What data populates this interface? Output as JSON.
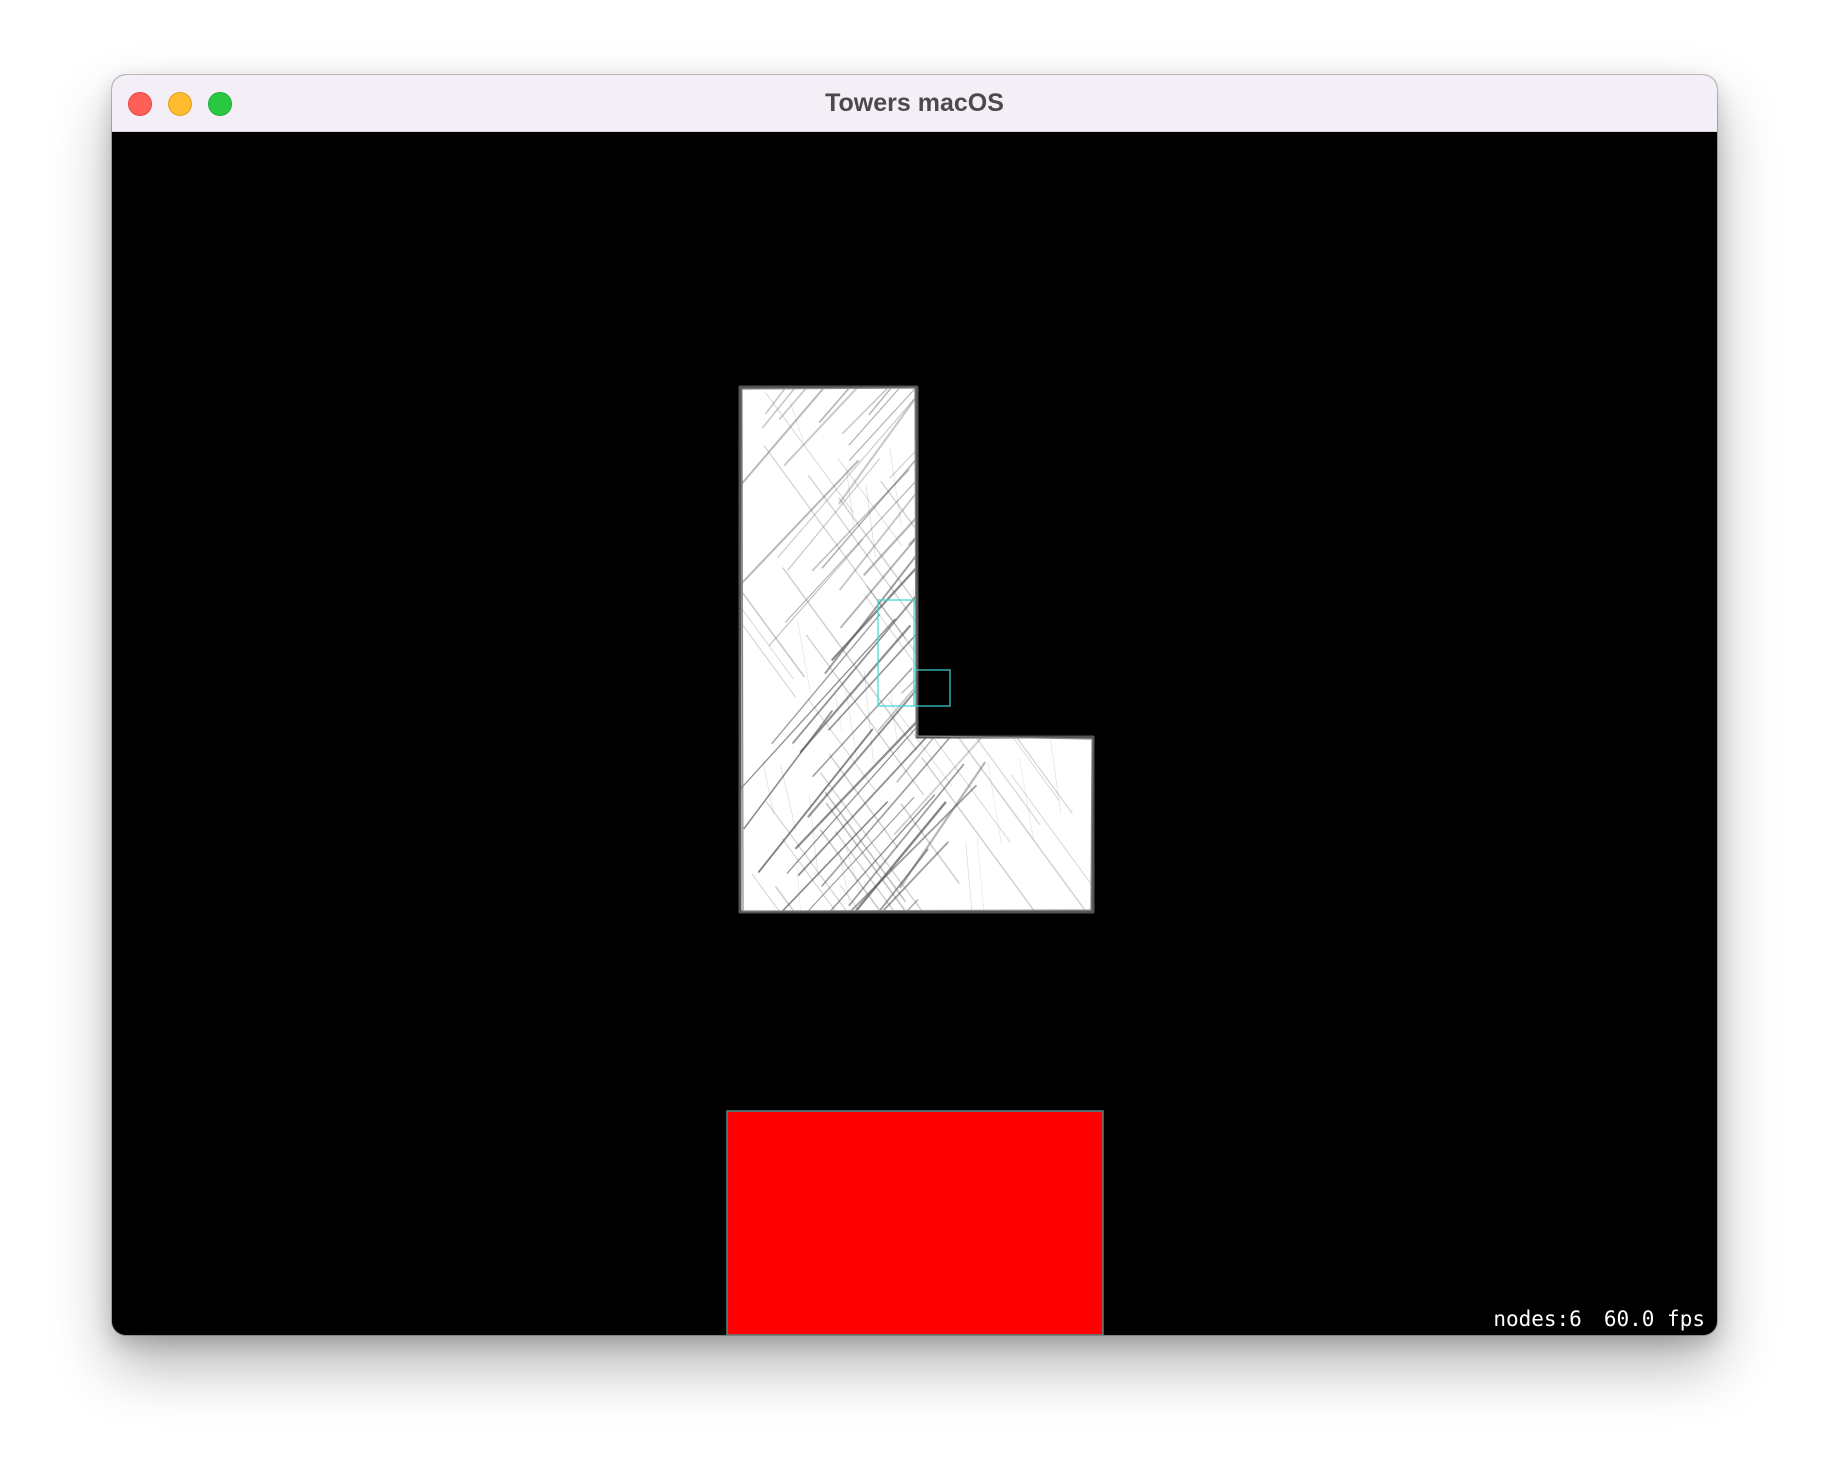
{
  "window": {
    "title": "Towers macOS",
    "background": "#000000"
  },
  "titlebar": {
    "background": "#f4eff6",
    "buttons": [
      {
        "name": "close",
        "color": "#ff5f57"
      },
      {
        "name": "minimize",
        "color": "#febc2e"
      },
      {
        "name": "zoom",
        "color": "#28c840"
      }
    ]
  },
  "scene": {
    "nodes": [
      {
        "name": "l-block",
        "kind": "sketched-tetromino",
        "shape": "L",
        "fill": "#ffffff",
        "stroke": "#444444"
      },
      {
        "name": "physics-outline-vertical",
        "kind": "debug-outline",
        "stroke": "#3fd6d6"
      },
      {
        "name": "physics-outline-horizontal",
        "kind": "debug-outline",
        "stroke": "#3fd6d6"
      },
      {
        "name": "base-platform",
        "kind": "platform",
        "fill": "#ff0000",
        "stroke": "#3c8c8c"
      }
    ]
  },
  "stats": {
    "nodes": "nodes:6",
    "fps": "60.0 fps"
  }
}
